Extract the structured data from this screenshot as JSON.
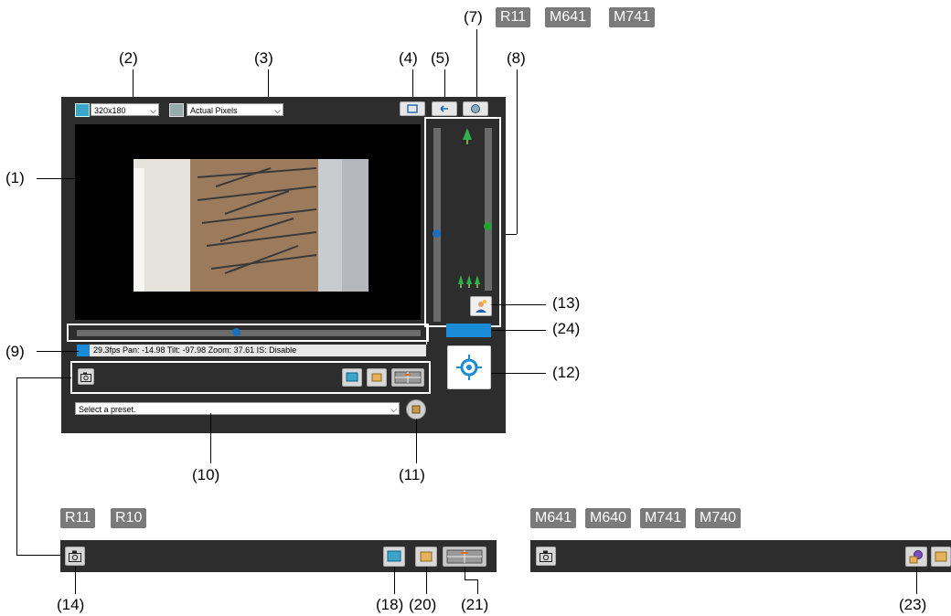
{
  "callouts": {
    "c1": "(1)",
    "c2": "(2)",
    "c3": "(3)",
    "c4": "(4)",
    "c5": "(5)",
    "c7": "(7)",
    "c8": "(8)",
    "c9": "(9)",
    "c10": "(10)",
    "c11": "(11)",
    "c12": "(12)",
    "c13": "(13)",
    "c14": "(14)",
    "c18": "(18)",
    "c20": "(20)",
    "c21": "(21)",
    "c23": "(23)",
    "c24": "(24)"
  },
  "badges": {
    "top": [
      "R11",
      "M641",
      "M741"
    ],
    "left_group": [
      "R11",
      "R10"
    ],
    "right_group": [
      "M641",
      "M640",
      "M741",
      "M740"
    ]
  },
  "viewer": {
    "video_size_value": "320x180",
    "display_size_value": "Actual Pixels",
    "status_text": "29.3fps Pan: -14.98 Tilt: -97.98 Zoom: 37.61 IS: Disable",
    "preset_placeholder": "Select a preset."
  },
  "icons": {
    "video_size": "video-size-icon",
    "display_size": "display-size-icon",
    "fullscreen": "fullscreen-icon",
    "back": "back-icon",
    "settings": "settings-icon",
    "snapshot": "camera-icon",
    "preset_go": "preset-go-icon",
    "backlight": "backlight-icon",
    "target": "target-icon",
    "view_mode": "view-mode-icon",
    "memory": "memory-icon",
    "split": "split-icon",
    "audio": "audio-icon"
  },
  "colors": {
    "panel": "#2d2d2d",
    "badge": "#7a7a7a",
    "accent_blue": "#1a8bd6"
  }
}
